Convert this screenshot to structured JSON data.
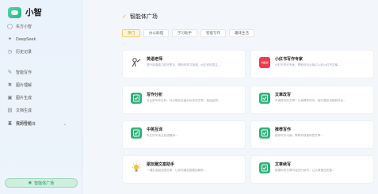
{
  "brand": {
    "name": "小智"
  },
  "sidebar": {
    "top_items": [
      {
        "label": "东方小智",
        "icon": "chat-icon"
      },
      {
        "label": "DeepSeek",
        "icon": "whale-icon"
      },
      {
        "label": "历史记录",
        "icon": "history-icon"
      }
    ],
    "tool_items": [
      {
        "label": "智能写作",
        "icon": "pen-icon"
      },
      {
        "label": "图片理解",
        "icon": "image-icon"
      },
      {
        "label": "图片生成",
        "icon": "picture-icon"
      },
      {
        "label": "文档生成",
        "icon": "document-icon"
      },
      {
        "label": "资源导航",
        "icon": "compass-icon"
      }
    ],
    "group_item": {
      "label": "我的智能体",
      "icon": "user-icon"
    },
    "bottom_button": "智能体广场"
  },
  "main": {
    "title": "智能体广场",
    "tabs": [
      "热门",
      "办公助理",
      "学习助手",
      "智能写作",
      "趣味生活"
    ],
    "cards": [
      {
        "title": "英语老师",
        "desc": "提升英语能力的好帮手，帮助你学习英语，纠正你的表达...",
        "icon": "teacher-icon",
        "icon_style": "plain"
      },
      {
        "title": "小红书写作专家",
        "desc": "小红书写作专家，帮助你写出吸引人的小红书文案...",
        "icon": "xiaohongshu-icon",
        "icon_style": "red",
        "icon_text": "小红书"
      },
      {
        "title": "写作分析",
        "desc": "专业的写作分析，可以帮你全面分析你的文章，包括结构...",
        "icon": "document-check-icon",
        "icon_style": "green"
      },
      {
        "title": "文章改写",
        "desc": "不满意你的文章？让我帮你改写，使它更加流畅和专业...",
        "icon": "document-check-icon",
        "icon_style": "green"
      },
      {
        "title": "中英互译",
        "desc": "专业的中英文双语翻译...",
        "icon": "document-check-icon",
        "icon_style": "green"
      },
      {
        "title": "推荐写作",
        "desc": "推荐写作大纲，帮助你快速构思文章...",
        "icon": "document-check-icon",
        "icon_style": "green"
      },
      {
        "title": "朋友圈文案助手",
        "desc": "一键生成朋友圈文案，让你的朋友圈更加精彩...",
        "icon": "bulb-icon",
        "icon_style": "bulb"
      },
      {
        "title": "文章续写",
        "desc": "根据你的文章内容进行续写，让文章更加完整...",
        "icon": "document-check-icon",
        "icon_style": "green"
      }
    ]
  },
  "colors": {
    "accent": "#2fb37a",
    "tab_active": "#fff6d8",
    "sidebar_bg": "#eaf2fb"
  }
}
